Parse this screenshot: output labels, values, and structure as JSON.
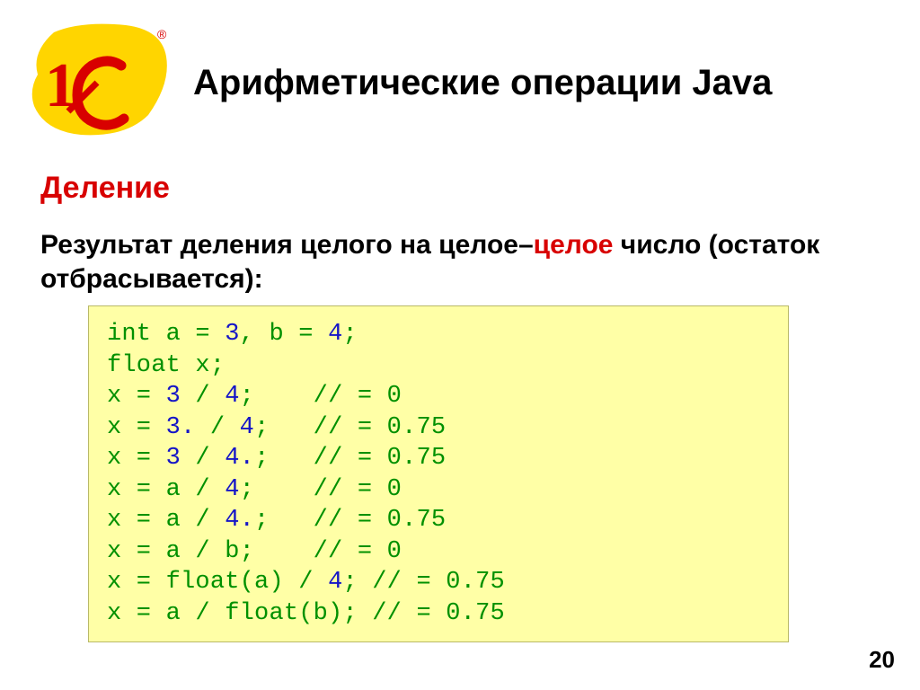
{
  "title": "Арифметические операции Java",
  "subtitle": "Деление",
  "descr_part1": "Результат деления целого на целое",
  "descr_dash": "–",
  "descr_red": "целое",
  "descr_part2": " число (остаток отбрасывается):",
  "code": {
    "l1_a": "int",
    "l1_b": " a = ",
    "l1_c": "3",
    "l1_d": ", b = ",
    "l1_e": "4",
    "l1_f": ";",
    "l2_a": "float",
    "l2_b": " x;",
    "l3_a": "x = ",
    "l3_b": "3",
    "l3_c": " / ",
    "l3_d": "4",
    "l3_e": ";    // = 0",
    "l4_a": "x = ",
    "l4_b": "3.",
    "l4_c": " / ",
    "l4_d": "4",
    "l4_e": ";   // = 0.75",
    "l5_a": "x = ",
    "l5_b": "3",
    "l5_c": " / ",
    "l5_d": "4.",
    "l5_e": ";   // = 0.75",
    "l6_a": "x = a / ",
    "l6_b": "4",
    "l6_c": ";    // = 0",
    "l7_a": "x = a / ",
    "l7_b": "4.",
    "l7_c": ";   // = 0.75",
    "l8": "x = a / b;    // = 0",
    "l9_a": "x = ",
    "l9_b": "float",
    "l9_c": "(a) / ",
    "l9_d": "4",
    "l9_e": "; // = 0.75",
    "l10_a": "x = a / ",
    "l10_b": "float",
    "l10_c": "(b); // = 0.75"
  },
  "slide_number": "20",
  "logo_text": "1C",
  "logo_reg": "®"
}
